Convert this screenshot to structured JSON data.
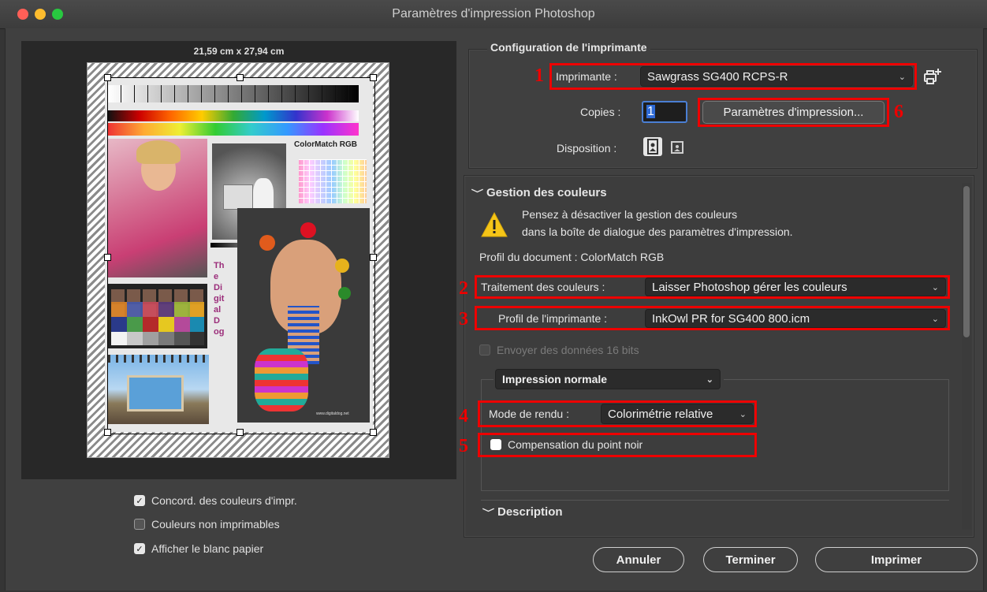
{
  "window": {
    "title": "Paramètres d'impression Photoshop",
    "traffic_colors": [
      "#ff5f57",
      "#febc2e",
      "#28c840"
    ]
  },
  "preview": {
    "dimensions": "21,59 cm x 27,94 cm",
    "image_caption": "ColorMatch RGB",
    "vertical_text": "The Digital Dog",
    "website": "www.digitaldog.net"
  },
  "options": {
    "match_print_colors": {
      "label": "Concord. des couleurs d'impr.",
      "checked": true
    },
    "gamut_warning": {
      "label": "Couleurs non imprimables",
      "checked": false
    },
    "show_paper_white": {
      "label": "Afficher le blanc papier",
      "checked": true
    }
  },
  "printer_setup": {
    "heading": "Configuration de l'imprimante",
    "printer_label": "Imprimante :",
    "printer_value": "Sawgrass SG400 RCPS-R",
    "copies_label": "Copies :",
    "copies_value": "1",
    "print_settings_button": "Paramètres d'impression...",
    "layout_label": "Disposition :"
  },
  "color_management": {
    "heading": "Gestion des couleurs",
    "warning_line1": "Pensez à désactiver la gestion des couleurs",
    "warning_line2": "dans la boîte de dialogue des paramètres d'impression.",
    "document_profile": "Profil du document : ColorMatch RGB",
    "color_handling_label": "Traitement des couleurs :",
    "color_handling_value": "Laisser Photoshop gérer les couleurs",
    "printer_profile_label": "Profil de l'imprimante :",
    "printer_profile_value": "InkOwl PR for SG400 800.icm",
    "send_16bit_label": "Envoyer des données 16 bits",
    "print_mode_value": "Impression normale",
    "rendering_intent_label": "Mode de rendu :",
    "rendering_intent_value": "Colorimétrie relative",
    "black_point_label": "Compensation du point noir"
  },
  "description": {
    "heading": "Description"
  },
  "annotations": [
    "1",
    "2",
    "3",
    "4",
    "5",
    "6"
  ],
  "annotation_color": "#e00000",
  "buttons": {
    "cancel": "Annuler",
    "done": "Terminer",
    "print": "Imprimer"
  }
}
